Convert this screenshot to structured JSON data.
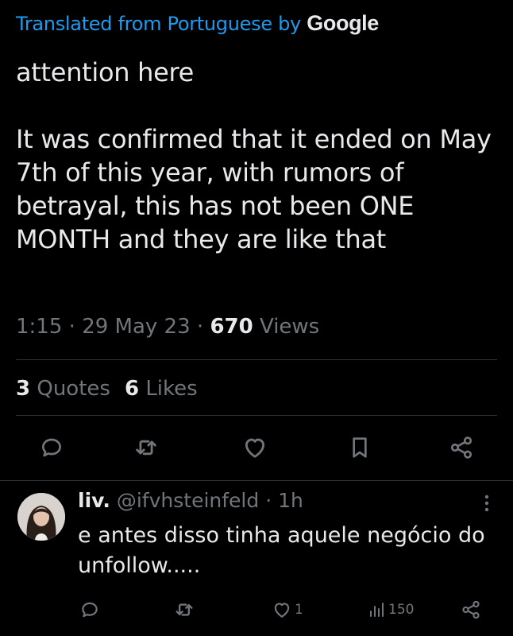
{
  "translation": {
    "prefix": "Translated from Portuguese by",
    "brand": "Google"
  },
  "tweet": {
    "line1": "attention here",
    "line2": "It was confirmed that it ended on May 7th of this year, with rumors of betrayal, this has not been ONE MONTH and they are like that",
    "time": "1:15",
    "dot1": "·",
    "date": "29 May 23",
    "dot2": "·",
    "views_count": "670",
    "views_label": "Views",
    "quotes_count": "3",
    "quotes_label": "Quotes",
    "likes_count": "6",
    "likes_label": "Likes"
  },
  "actions": {
    "reply_icon": "reply-icon",
    "retweet_icon": "retweet-icon",
    "like_icon": "heart-icon",
    "bookmark_icon": "bookmark-icon",
    "share_icon": "share-icon"
  },
  "reply": {
    "name": "liv.",
    "handle": "@ifvhsteinfeld",
    "dot": "·",
    "time": "1h",
    "text": "e antes disso tinha aquele negócio do unfollow.....",
    "likes": "1",
    "views": "150"
  },
  "colors": {
    "background": "#000000",
    "text": "#e7e9ea",
    "muted": "#71767b",
    "accent": "#1d9bf0",
    "divider": "#2f3336"
  }
}
